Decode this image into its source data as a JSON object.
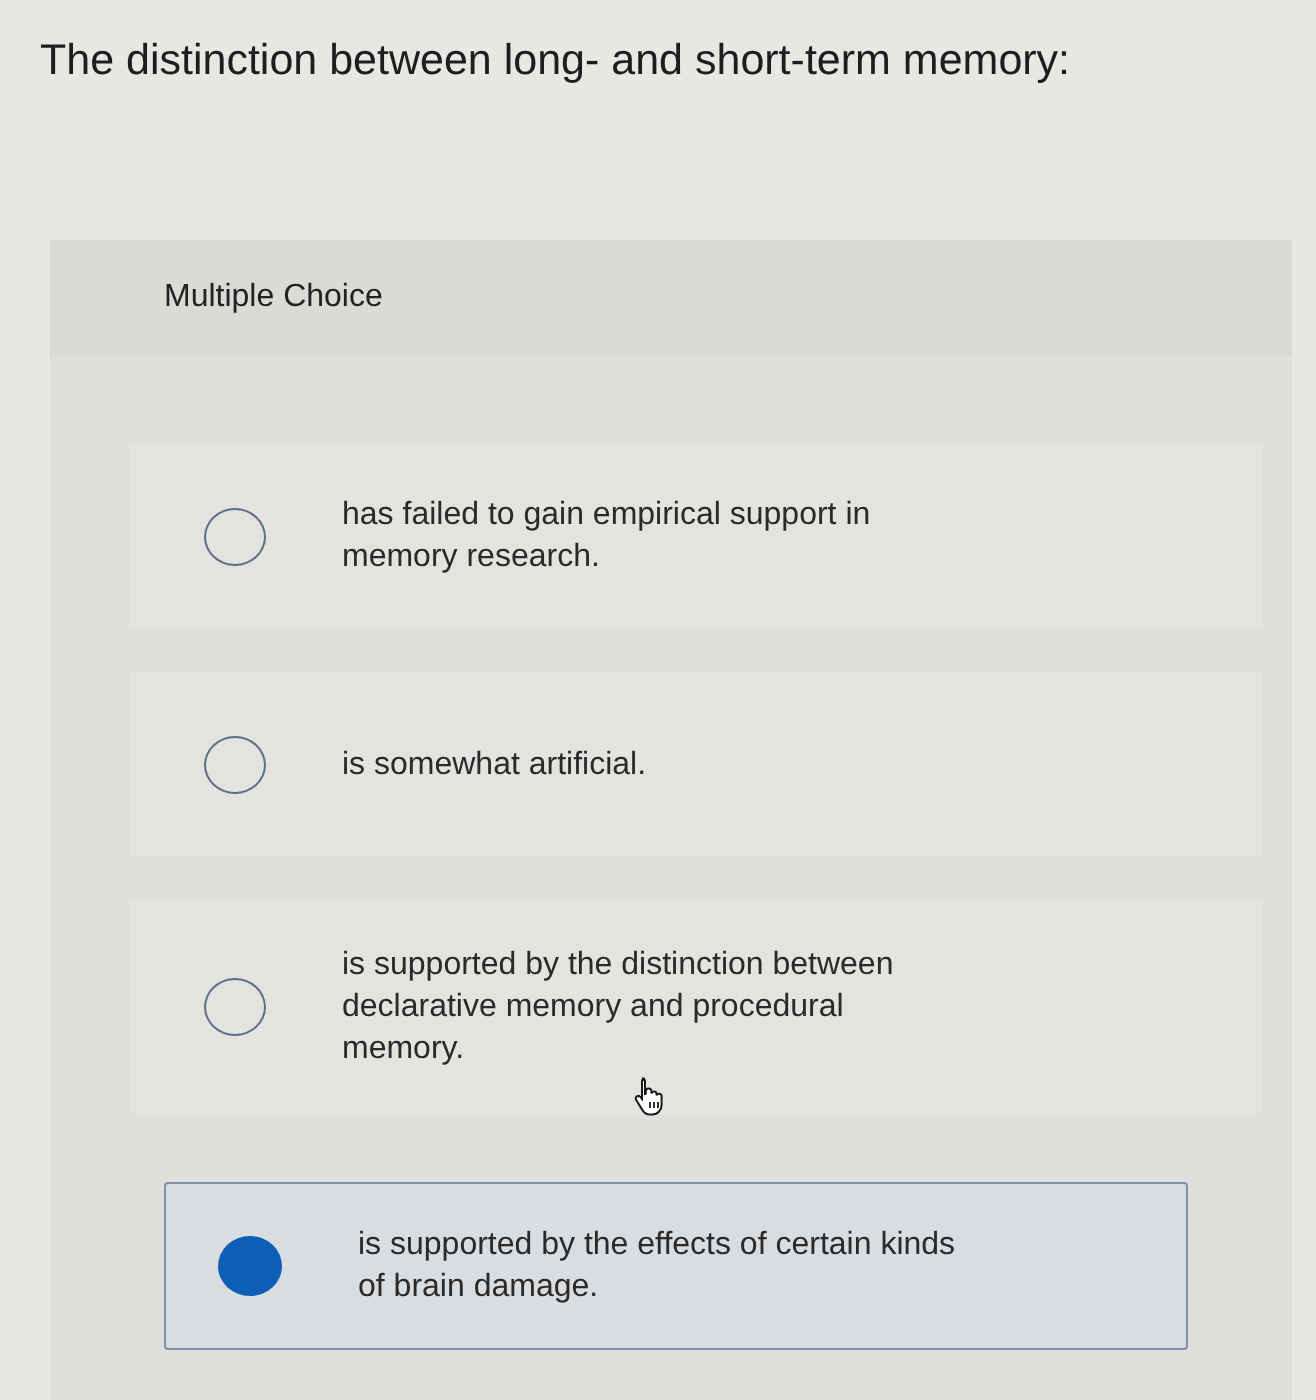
{
  "question": {
    "text": "The distinction between long- and short-term memory:"
  },
  "question_type": "Multiple Choice",
  "options": [
    {
      "text": "has failed to gain empirical support in memory research.",
      "selected": false
    },
    {
      "text": "is somewhat artificial.",
      "selected": false
    },
    {
      "text": "is supported by the distinction between declarative memory and procedural memory.",
      "selected": false
    },
    {
      "text": "is supported by the effects of certain kinds of brain damage.",
      "selected": true
    }
  ]
}
